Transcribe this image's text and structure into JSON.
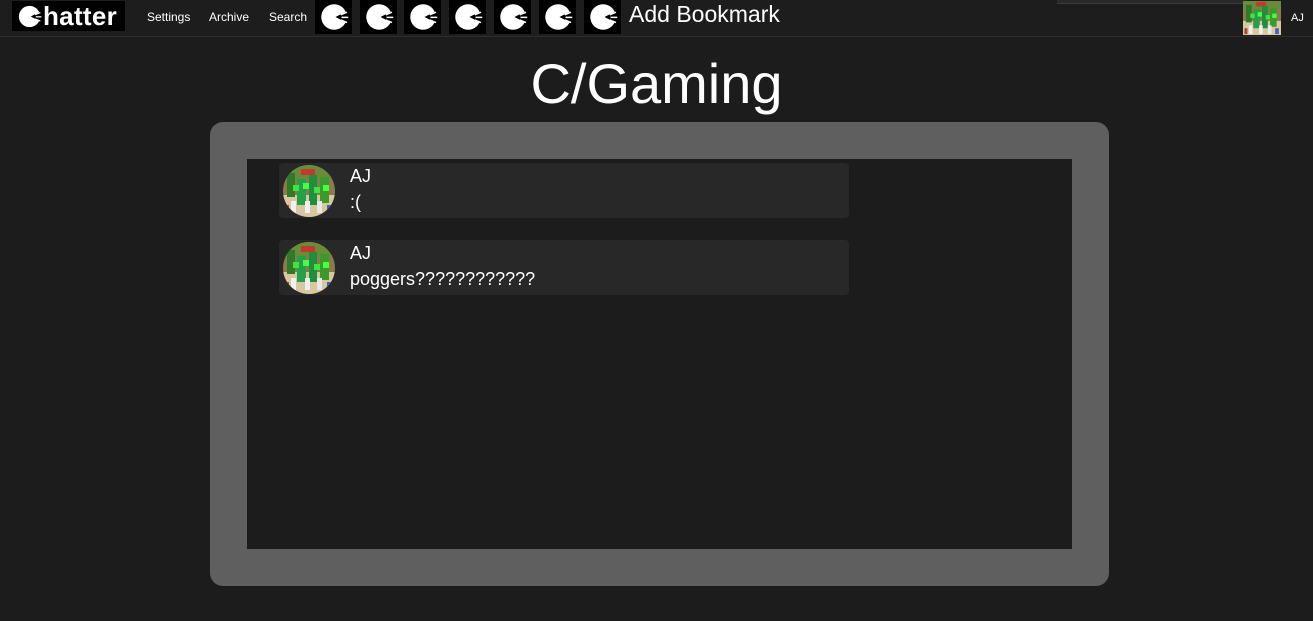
{
  "navbar": {
    "logo_text": "hatter",
    "links": {
      "settings": "Settings",
      "archive": "Archive",
      "search": "Search"
    },
    "bookmarks": [
      "chatter-icon",
      "chatter-icon",
      "chatter-icon",
      "chatter-icon",
      "chatter-icon",
      "chatter-icon",
      "chatter-icon"
    ],
    "add_bookmark": "Add Bookmark",
    "user": {
      "name": "AJ",
      "avatar_icon": "user-avatar-image"
    }
  },
  "page": {
    "title": "C/Gaming"
  },
  "messages": [
    {
      "author": "AJ",
      "text": ":("
    },
    {
      "author": "AJ",
      "text": "poggers????????????"
    }
  ],
  "colors": {
    "background": "#1c1c1c",
    "panel": "#5f5f5f",
    "message_bg": "#282828",
    "logo_bg": "#000000"
  }
}
